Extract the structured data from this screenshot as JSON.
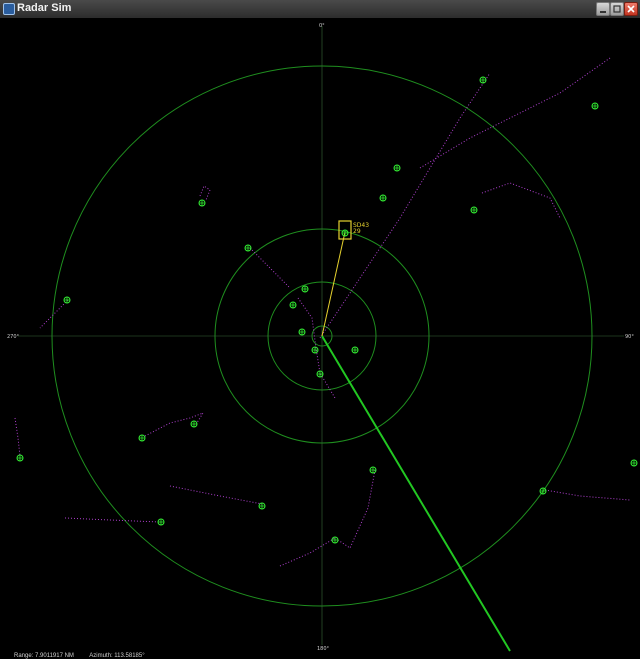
{
  "window": {
    "title": "Radar Sim"
  },
  "colors": {
    "rings": "#1f8f1f",
    "axes": "#3a6a3a",
    "target": "#33ee33",
    "trail": "#b040d0",
    "sweep": "#22c722",
    "selected": "#e6d22e",
    "label": "#e6d22e"
  },
  "compass": {
    "north": "0°",
    "east": "90°",
    "south": "180°",
    "west": "270°"
  },
  "selected_target": {
    "id": "SD43",
    "value": "29"
  },
  "status": {
    "range": "Range: 7.9011917 NM",
    "azimuth": "Azimuth: 113.58185°"
  },
  "icons": {
    "minimize": "minimize-icon",
    "maximize": "maximize-icon",
    "close": "close-icon",
    "app": "radar-app-icon"
  }
}
